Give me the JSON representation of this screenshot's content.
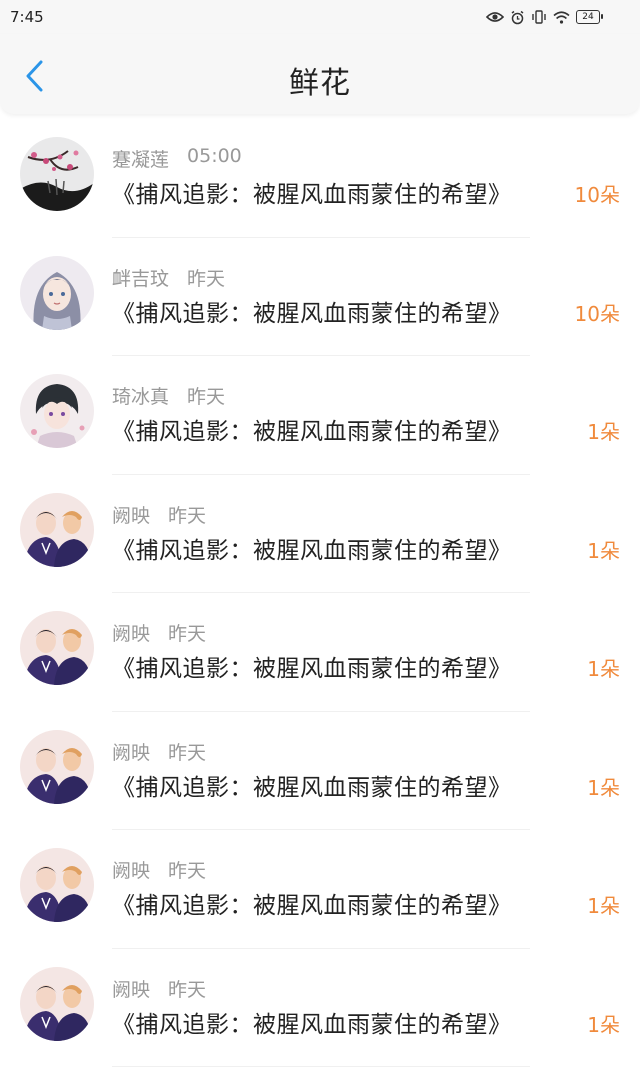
{
  "status_bar": {
    "time": "7:45",
    "battery": "24",
    "icons": [
      "eye-icon",
      "alarm-icon",
      "vibrate-icon",
      "wifi-icon",
      "battery-icon"
    ]
  },
  "header": {
    "title": "鲜花",
    "back_icon": "chevron-left-icon"
  },
  "colors": {
    "accent_blue": "#2b95e8",
    "count_orange": "#f08a3c"
  },
  "list": {
    "items": [
      {
        "user": "蹇凝莲",
        "time": "05:00",
        "title": "《捕风追影：被腥风血雨蒙住的希望》",
        "count": "10朵",
        "avatar": "plum-blossom-avatar"
      },
      {
        "user": "衅吉玟",
        "time": "昨天",
        "title": "《捕风追影：被腥风血雨蒙住的希望》",
        "count": "10朵",
        "avatar": "anime-girl-avatar"
      },
      {
        "user": "琦冰真",
        "time": "昨天",
        "title": "《捕风追影：被腥风血雨蒙住的希望》",
        "count": "1朵",
        "avatar": "anime-boy-avatar"
      },
      {
        "user": "阙映",
        "time": "昨天",
        "title": "《捕风追影：被腥风血雨蒙住的希望》",
        "count": "1朵",
        "avatar": "couple-avatar"
      },
      {
        "user": "阙映",
        "time": "昨天",
        "title": "《捕风追影：被腥风血雨蒙住的希望》",
        "count": "1朵",
        "avatar": "couple-avatar"
      },
      {
        "user": "阙映",
        "time": "昨天",
        "title": "《捕风追影：被腥风血雨蒙住的希望》",
        "count": "1朵",
        "avatar": "couple-avatar"
      },
      {
        "user": "阙映",
        "time": "昨天",
        "title": "《捕风追影：被腥风血雨蒙住的希望》",
        "count": "1朵",
        "avatar": "couple-avatar"
      },
      {
        "user": "阙映",
        "time": "昨天",
        "title": "《捕风追影：被腥风血雨蒙住的希望》",
        "count": "1朵",
        "avatar": "couple-avatar"
      }
    ]
  }
}
